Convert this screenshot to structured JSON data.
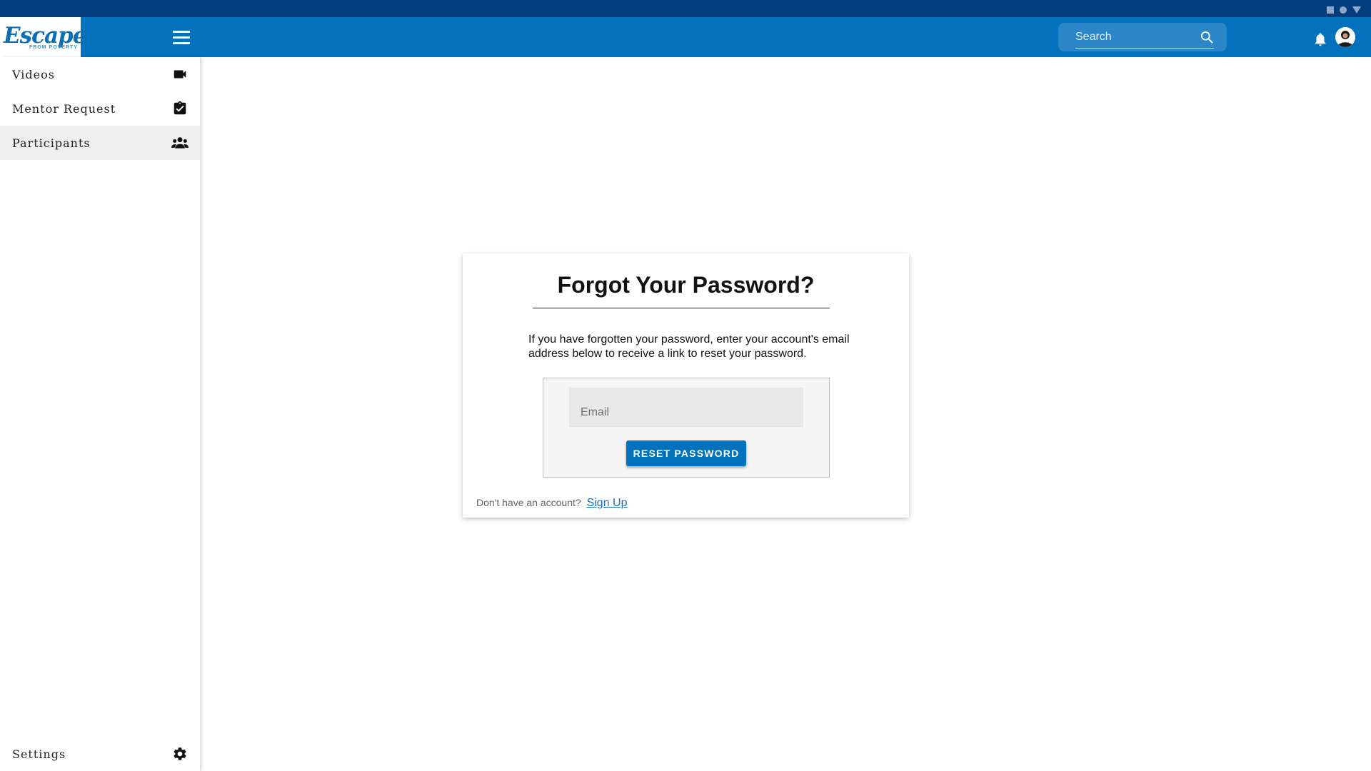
{
  "status_bar": {
    "icons": [
      "square-icon",
      "circle-icon",
      "triangle-icon"
    ]
  },
  "app_bar": {
    "logo": {
      "main": "Escape",
      "sub": "FROM POVERTY"
    },
    "search": {
      "placeholder": "Search"
    },
    "icons": [
      "hamburger-menu-icon",
      "search-icon",
      "bell-icon",
      "avatar"
    ]
  },
  "sidebar": {
    "items": [
      {
        "label": "Videos",
        "icon": "video-camera-icon"
      },
      {
        "label": "Mentor Request",
        "icon": "clipboard-check-icon"
      },
      {
        "label": "Participants",
        "icon": "group-icon",
        "active": true
      }
    ],
    "footer_item": {
      "label": "Settings",
      "icon": "gear-icon"
    }
  },
  "card": {
    "title": "Forgot Your Password?",
    "description": "If you have forgotten your password, enter your account's email address below to receive a link to reset your password.",
    "email_placeholder": "Email",
    "reset_button": "RESET PASSWORD",
    "signup_prompt": "Don't have an account?",
    "signup_link": "Sign Up"
  },
  "colors": {
    "primary": "#0272bc",
    "status_bar": "#023d7e",
    "active_nav": "#eeeeee",
    "link": "#1a6fc0"
  }
}
